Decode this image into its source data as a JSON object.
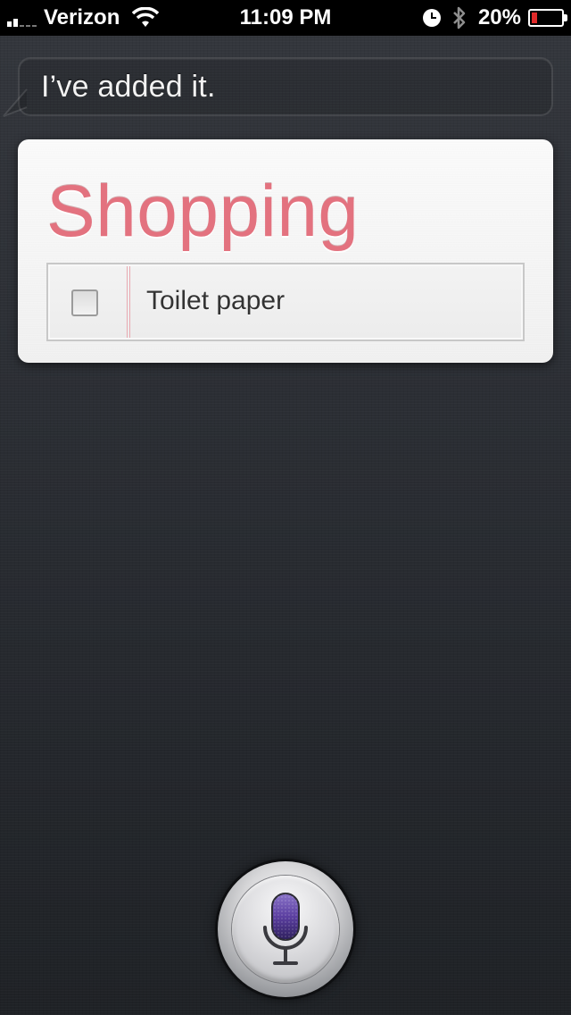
{
  "status_bar": {
    "carrier": "Verizon",
    "time": "11:09 PM",
    "battery_percent": "20%",
    "battery_level": 0.2,
    "icons": [
      "signal-bars-icon",
      "wifi-icon",
      "clock-icon",
      "bluetooth-icon",
      "battery-icon"
    ]
  },
  "siri": {
    "response": "I’ve added it."
  },
  "reminders_card": {
    "list_title": "Shopping",
    "items": [
      {
        "label": "Toilet paper",
        "checked": false
      }
    ]
  },
  "mic_button": {
    "icon": "microphone-icon"
  },
  "colors": {
    "list_title": "#e3727f",
    "mic_accent": "#5b3fa0"
  }
}
